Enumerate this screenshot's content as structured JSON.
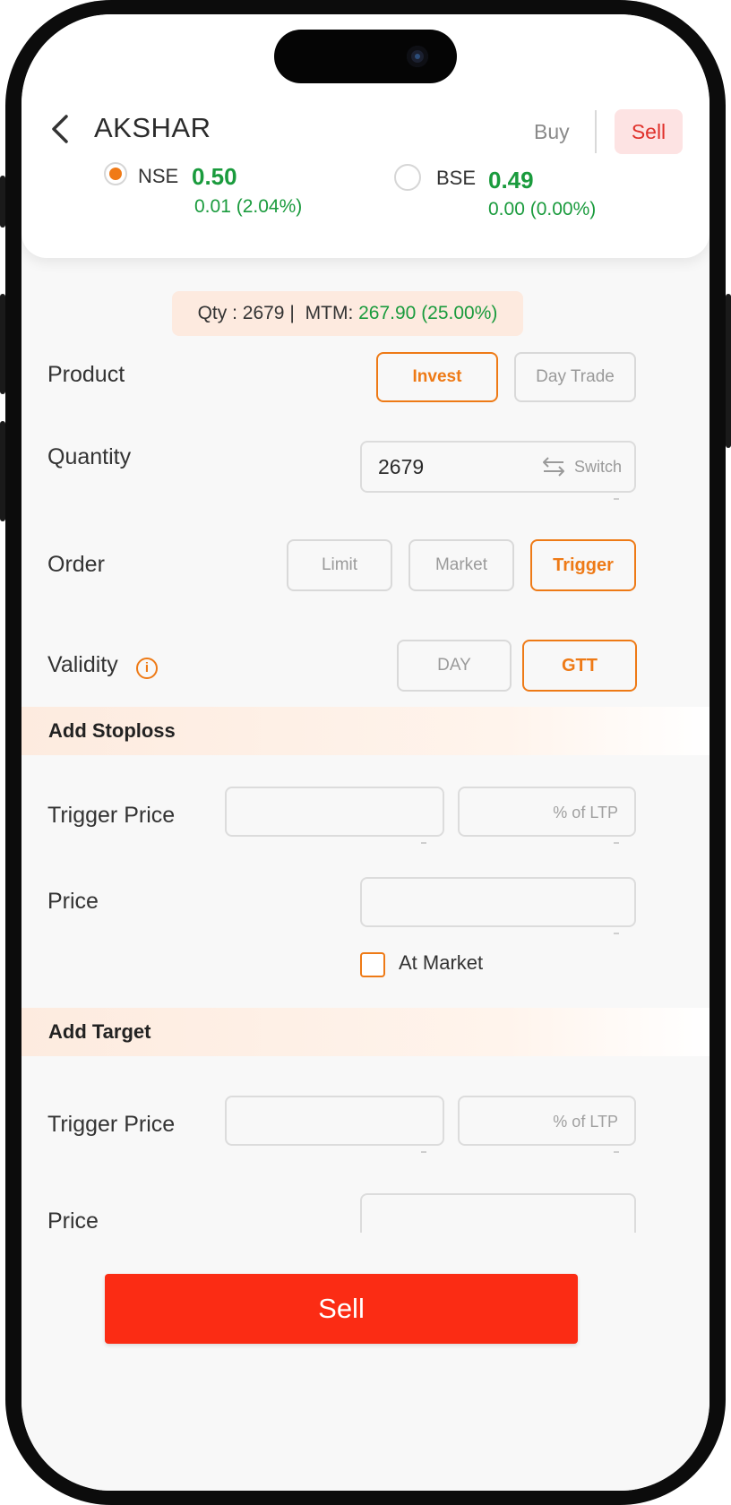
{
  "header": {
    "title": "AKSHAR",
    "buy_tab": "Buy",
    "sell_tab": "Sell"
  },
  "exchanges": [
    {
      "name": "NSE",
      "price": "0.50",
      "change": "0.01 (2.04%)",
      "selected": true
    },
    {
      "name": "BSE",
      "price": "0.49",
      "change": "0.00 (0.00%)",
      "selected": false
    }
  ],
  "position": {
    "qty_text": "Qty : 2679 |",
    "mtm_label": "MTM:",
    "mtm_value": "267.90 (25.00%)"
  },
  "product": {
    "label": "Product",
    "options": [
      "Invest",
      "Day Trade"
    ],
    "selected": "Invest"
  },
  "quantity": {
    "label": "Quantity",
    "value": "2679",
    "switch_label": "Switch"
  },
  "order": {
    "label": "Order",
    "options": [
      "Limit",
      "Market",
      "Trigger"
    ],
    "selected": "Trigger"
  },
  "validity": {
    "label": "Validity",
    "options": [
      "DAY",
      "GTT"
    ],
    "selected": "GTT"
  },
  "stoploss": {
    "heading": "Add Stoploss",
    "trigger_label": "Trigger Price",
    "trigger_value": "",
    "ltp_placeholder": "% of LTP",
    "price_label": "Price",
    "price_value": "",
    "at_market_label": "At Market",
    "at_market_checked": false
  },
  "target": {
    "heading": "Add Target",
    "trigger_label": "Trigger Price",
    "trigger_value": "",
    "ltp_placeholder": "% of LTP",
    "price_label": "Price",
    "price_value": ""
  },
  "action": {
    "sell_button": "Sell"
  },
  "colors": {
    "accent": "#ee7a16",
    "positive": "#1a9b3d",
    "sell": "#fb2c14"
  }
}
